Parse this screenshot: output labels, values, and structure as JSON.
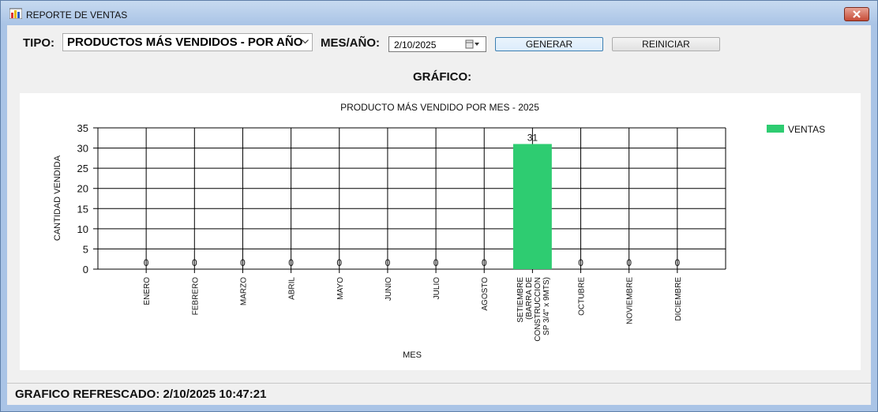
{
  "window": {
    "title": "REPORTE DE VENTAS",
    "icon": "bar-chart-app-icon",
    "close_icon": "close-x-icon"
  },
  "toolbar": {
    "tipo_label": "TIPO:",
    "tipo_value": "PRODUCTOS MÁS VENDIDOS - POR AÑO",
    "mes_label": "MES/AÑO:",
    "date_value": "2/10/2025",
    "generar_label": "GENERAR",
    "reiniciar_label": "REINICIAR"
  },
  "grafico_label": "GRÁFICO:",
  "status": {
    "text": "GRAFICO REFRESCADO: 2/10/2025 10:47:21"
  },
  "colors": {
    "bar": "#2ecc71",
    "close": "#c64b36",
    "window_frame": "#aac4e6"
  },
  "chart_data": {
    "type": "bar",
    "title": "PRODUCTO MÁS VENDIDO POR MES - 2025",
    "xlabel": "MES",
    "ylabel": "CANTIDAD VENDIDA",
    "ylim": [
      0,
      35
    ],
    "yticks": [
      0,
      5,
      10,
      15,
      20,
      25,
      30,
      35
    ],
    "grid": true,
    "legend_position": "top-right",
    "categories": [
      [
        "ENERO"
      ],
      [
        "FEBRERO"
      ],
      [
        "MARZO"
      ],
      [
        "ABRIL"
      ],
      [
        "MAYO"
      ],
      [
        "JUNIO"
      ],
      [
        "JULIO"
      ],
      [
        "AGOSTO"
      ],
      [
        "SETIEMBRE",
        "(BARRA DE",
        "CONSTRUCCION",
        "SP 3/4\" x 9MTS)"
      ],
      [
        "OCTUBRE"
      ],
      [
        "NOVIEMBRE"
      ],
      [
        "DICIEMBRE"
      ]
    ],
    "series": [
      {
        "name": "VENTAS",
        "color": "#2ecc71",
        "values": [
          0,
          0,
          0,
          0,
          0,
          0,
          0,
          0,
          31,
          0,
          0,
          0
        ]
      }
    ]
  }
}
